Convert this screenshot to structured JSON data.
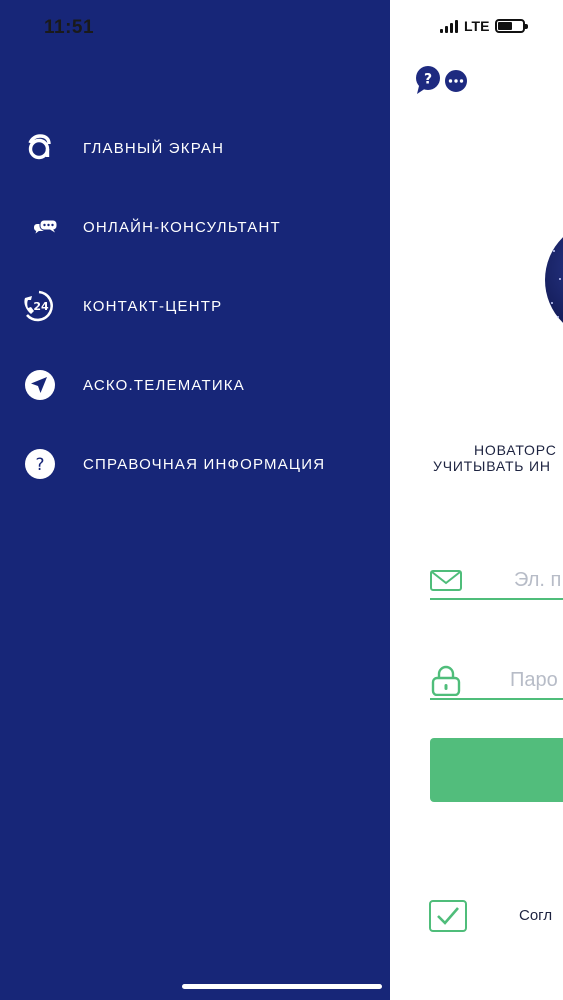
{
  "status_bar": {
    "time": "11:51",
    "network": "LTE"
  },
  "menu": {
    "items": [
      {
        "label": "ГЛАВНЫЙ ЭКРАН",
        "icon": "asko-logo-icon"
      },
      {
        "label": "ОНЛАЙН-КОНСУЛЬТАНТ",
        "icon": "chat-bubbles-icon"
      },
      {
        "label": "КОНТАКТ-ЦЕНТР",
        "icon": "phone-24-icon"
      },
      {
        "label": "АСКО.ТЕЛЕМАТИКА",
        "icon": "navigation-arrow-icon"
      },
      {
        "label": "СПРАВОЧНАЯ ИНФОРМАЦИЯ",
        "icon": "question-icon"
      }
    ]
  },
  "main": {
    "tagline_line1": "НОВАТОРС",
    "tagline_line2": "УЧИТЫВАТЬ ИН",
    "email_placeholder": "Эл. п",
    "password_placeholder": "Паро",
    "agreement_text": "Согл"
  },
  "colors": {
    "drawer_bg": "#172678",
    "accent_green": "#52bd7c",
    "text_dark": "#1d2340"
  }
}
